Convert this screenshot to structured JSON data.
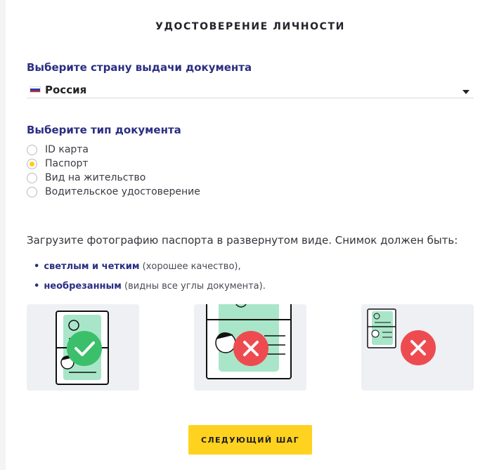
{
  "title": "УДОСТОВЕРЕНИЕ ЛИЧНОСТИ",
  "country": {
    "label": "Выберите страну выдачи документа",
    "selected": "Россия",
    "flag_colors": [
      "#ffffff",
      "#1c3fb8",
      "#d52b1e"
    ]
  },
  "doc_type": {
    "label": "Выберите тип документа",
    "options": [
      {
        "label": "ID карта",
        "checked": false
      },
      {
        "label": "Паспорт",
        "checked": true
      },
      {
        "label": "Вид на жительство",
        "checked": false
      },
      {
        "label": "Водительское удостоверение",
        "checked": false
      }
    ]
  },
  "instruction": "Загрузите фотографию паспорта в развернутом виде. Снимок должен быть:",
  "bullets": [
    {
      "strong": "светлым и четким",
      "rest": " (хорошее качество),"
    },
    {
      "strong": "необрезанным",
      "rest": " (видны все углы документа)."
    }
  ],
  "examples": [
    {
      "icon": "check-icon",
      "status": "good",
      "color": "#3bbf6b"
    },
    {
      "icon": "cross-icon",
      "status": "bad",
      "color": "#ee4b51"
    },
    {
      "icon": "cross-icon",
      "status": "bad",
      "color": "#ee4b51"
    }
  ],
  "next_button": "СЛЕДУЮЩИЙ ШАГ",
  "colors": {
    "accent": "#ffd21f",
    "heading": "#2b2e82",
    "radio_checked": "#ffcf10"
  }
}
